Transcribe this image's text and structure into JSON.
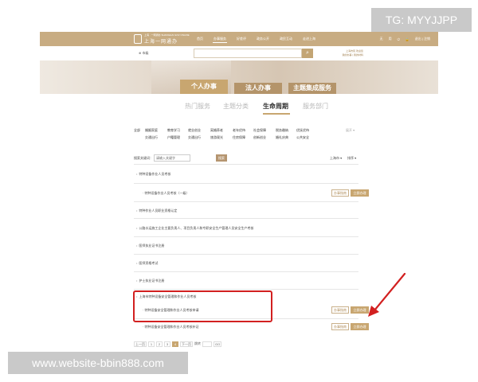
{
  "watermarks": {
    "tag": "TG: MYYJJPP",
    "site": "www.website-bbin888.com"
  },
  "colors": {
    "brand_gold": "#c8ac82",
    "button_gold": "#c8a670",
    "highlight_red": "#d22020"
  },
  "header": {
    "logo_sub": "上海 · 一网通办 SHANGHAI GOV ONLINE",
    "logo_main": "上海一网通办",
    "nav": [
      "首页",
      "办事服务",
      "好差评",
      "政务公开",
      "政民互动",
      "走进上海"
    ],
    "nav_active_index": 1,
    "tools": [
      "无",
      "用",
      "⏻",
      "🔒",
      "退出 | 注销"
    ]
  },
  "search": {
    "location": "⊕ 市级",
    "placeholder": "",
    "button_icon": "search-icon",
    "user_line1": "上海市民 欢迎您",
    "user_line2": "我的办事 | 我的材料"
  },
  "banner": {
    "tabs": [
      "个人办事",
      "法人办事",
      "主题集成服务"
    ],
    "active_index": 0
  },
  "subtabs": {
    "items": [
      "热门服务",
      "主题分类",
      "生命周期",
      "服务部门"
    ],
    "active_index": 2
  },
  "filter": {
    "rows": [
      [
        "全部",
        "婚姻家庭",
        "教育学习",
        "就业创业",
        "离婚养老",
        "老年优待",
        "社会保障",
        "税务缴纳",
        "优抚优待"
      ],
      [
        "",
        "交通出行",
        "户籍管理",
        "交通出行",
        "旅游观光",
        "住房保障",
        "创新创业",
        "婚礼庆典",
        "公共安全"
      ]
    ],
    "more": "展开 ▾"
  },
  "keyword": {
    "label": "搜索关键词：",
    "value": "请输入关键字",
    "button": "搜索",
    "sort1": "上海市 ▾",
    "sort2": "排序 ▾"
  },
  "list": {
    "items": [
      {
        "title": "特种设备作业人员考核",
        "sub": null,
        "buttons": false
      },
      {
        "title": null,
        "sub": "特种设备作业人员考核（一级）",
        "buttons": true
      },
      {
        "title": "特种作业人员职业资格认定",
        "sub": null,
        "buttons": false
      },
      {
        "title": "公路水运施工企业主要负责人、项目负责人和专职安全生产管理人员安全生产考核",
        "sub": null,
        "buttons": false
      },
      {
        "title": "医师执业证书注册",
        "sub": null,
        "buttons": false
      },
      {
        "title": "医师资格考试",
        "sub": null,
        "buttons": false
      },
      {
        "title": "护士执业证书注册",
        "sub": null,
        "buttons": false
      },
      {
        "title": "上海市特种设备安全管理和作业人员考核",
        "sub": null,
        "buttons": false
      },
      {
        "title": null,
        "sub": "特种设备安全管理和作业人员考核申请",
        "buttons": true
      },
      {
        "title": null,
        "sub": "特种设备安全管理和作业人员考核补证",
        "buttons": true
      }
    ],
    "guide_label": "办事指南",
    "go_label": "立即办理"
  },
  "pager": {
    "first": "上一页",
    "pages": [
      "1",
      "2",
      "3",
      "4"
    ],
    "active_index": 3,
    "next": "下一页",
    "jump_label": "跳转",
    "go": "GO"
  }
}
